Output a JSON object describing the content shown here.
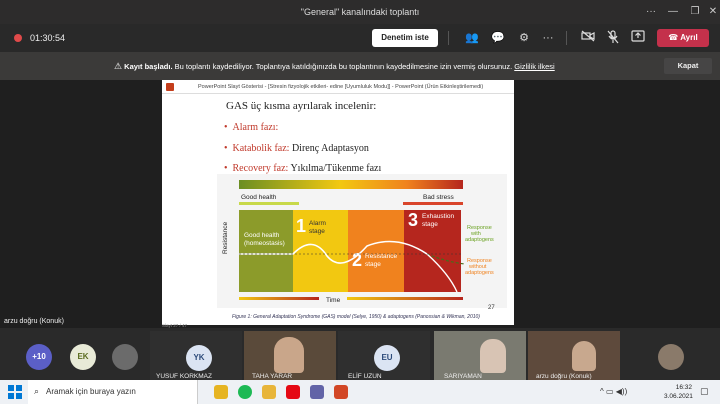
{
  "window": {
    "title": "\"General\" kanalındaki toplantı"
  },
  "callbar": {
    "timer": "01:30:54",
    "review_label": "Denetim iste",
    "leave_label": "Ayrıl"
  },
  "banner": {
    "bold": "Kayıt başladı.",
    "message": "Bu toplantı kaydediliyor. Toplantıya katıldığınızda bu toplantının kaydedilmesine izin vermiş olursunuz.",
    "link": "Gizlilik ilkesi",
    "close_label": "Kapat"
  },
  "ppt": {
    "title": "PowerPoint Slayt Gösterisi - [Stresin fizyolojik etkileri- edine [Uyumluluk Modu]] - PowerPoint (Ürün Etkinleştirilemedi)"
  },
  "slide": {
    "heading": "GAS üç kısma ayrılarak incelenir:",
    "bullets": [
      {
        "red": "Alarm fazı:",
        "rest": ""
      },
      {
        "red": "Katabolik faz:",
        "rest": " Direnç Adaptasyon"
      },
      {
        "red": "Recovery faz:",
        "rest": " Yıkılma/Tükenme fazı"
      }
    ],
    "page_number": "27",
    "caption": "Figure 1: General Adaptation Syndrome (GAS) model (Selye, 1950) & adaptogens (Panossian & Wikman, 2010)",
    "footer": "Slayt 27 / 47"
  },
  "diagram": {
    "good_health_top": "Good health",
    "bad_stress_top": "Bad stress",
    "y_axis": "Resistance",
    "x_axis": "Time",
    "stage_homeostasis": "Good health (homeostasis)",
    "stage1_num": "1",
    "stage1": "Alarm stage",
    "stage2_num": "2",
    "stage2": "Resistance stage",
    "stage3_num": "3",
    "stage3": "Exhaustion stage",
    "with_adaptogens": "Response with adaptogens",
    "without_adaptogens": "Response without adaptogens",
    "colors": {
      "green": "#8c9b2a",
      "yellow": "#f2c811",
      "orange": "#f0821e",
      "red": "#b5261e"
    }
  },
  "presenter": {
    "label": "arzu doğru (Konuk)"
  },
  "participants": {
    "more_count": "+10",
    "ek_initials": "EK",
    "yk_initials": "YK",
    "yk_name": "YUSUF KORKMAZ",
    "taha_name": "TAHA YARAR",
    "eu_initials": "EU",
    "eu_name": "ELİF UZUN",
    "sariyaman_name": "SARIYAMAN",
    "arzu_name": "arzu doğru (Konuk)"
  },
  "taskbar": {
    "search_placeholder": "Aramak için buraya yazın",
    "time": "16:32",
    "date": "3.06.2021"
  }
}
